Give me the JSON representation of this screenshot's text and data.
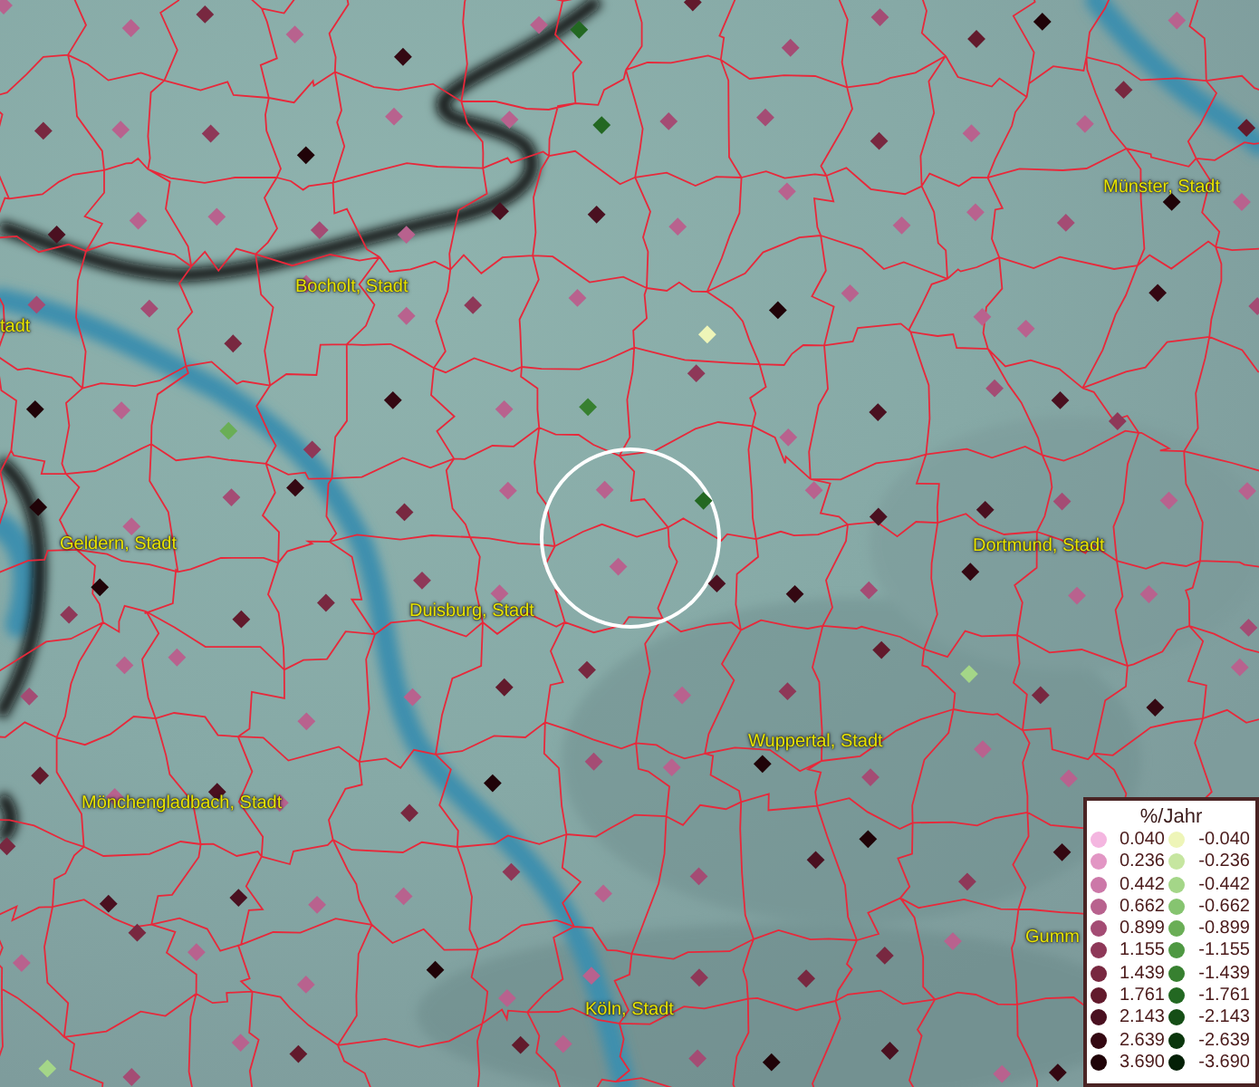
{
  "map": {
    "places": [
      {
        "name": "tadt"
      },
      {
        "name": "Bocholt, Stadt"
      },
      {
        "name": "Münster, Stadt"
      },
      {
        "name": "Geldern, Stadt"
      },
      {
        "name": "Duisburg, Stadt"
      },
      {
        "name": "Dortmund, Stadt"
      },
      {
        "name": "Wuppertal, Stadt"
      },
      {
        "name": "Mönchengladbach, Stadt"
      },
      {
        "name": "Köln, Stadt"
      },
      {
        "name": "Gumm"
      }
    ]
  },
  "legend": {
    "title": "%/Jahr",
    "rows": [
      {
        "pos": {
          "value": "0.040",
          "color": "#f4b6e0"
        },
        "neg": {
          "value": "-0.040",
          "color": "#eef5b8"
        }
      },
      {
        "pos": {
          "value": "0.236",
          "color": "#e296c4"
        },
        "neg": {
          "value": "-0.236",
          "color": "#c6e6a0"
        }
      },
      {
        "pos": {
          "value": "0.442",
          "color": "#cc78a8"
        },
        "neg": {
          "value": "-0.442",
          "color": "#a4d688"
        }
      },
      {
        "pos": {
          "value": "0.662",
          "color": "#b8628e"
        },
        "neg": {
          "value": "-0.662",
          "color": "#86c470"
        }
      },
      {
        "pos": {
          "value": "0.899",
          "color": "#a44c74"
        },
        "neg": {
          "value": "-0.899",
          "color": "#6aae56"
        }
      },
      {
        "pos": {
          "value": "1.155",
          "color": "#8e3858"
        },
        "neg": {
          "value": "-1.155",
          "color": "#4e9842"
        }
      },
      {
        "pos": {
          "value": "1.439",
          "color": "#782840"
        },
        "neg": {
          "value": "-1.439",
          "color": "#378030"
        }
      },
      {
        "pos": {
          "value": "1.761",
          "color": "#621a2c"
        },
        "neg": {
          "value": "-1.761",
          "color": "#236822"
        }
      },
      {
        "pos": {
          "value": "2.143",
          "color": "#4a1020"
        },
        "neg": {
          "value": "-2.143",
          "color": "#154e16"
        }
      },
      {
        "pos": {
          "value": "2.639",
          "color": "#340812"
        },
        "neg": {
          "value": "-2.639",
          "color": "#0a360c"
        }
      },
      {
        "pos": {
          "value": "3.690",
          "color": "#200308"
        },
        "neg": {
          "value": "-3.690",
          "color": "#042006"
        }
      }
    ]
  }
}
